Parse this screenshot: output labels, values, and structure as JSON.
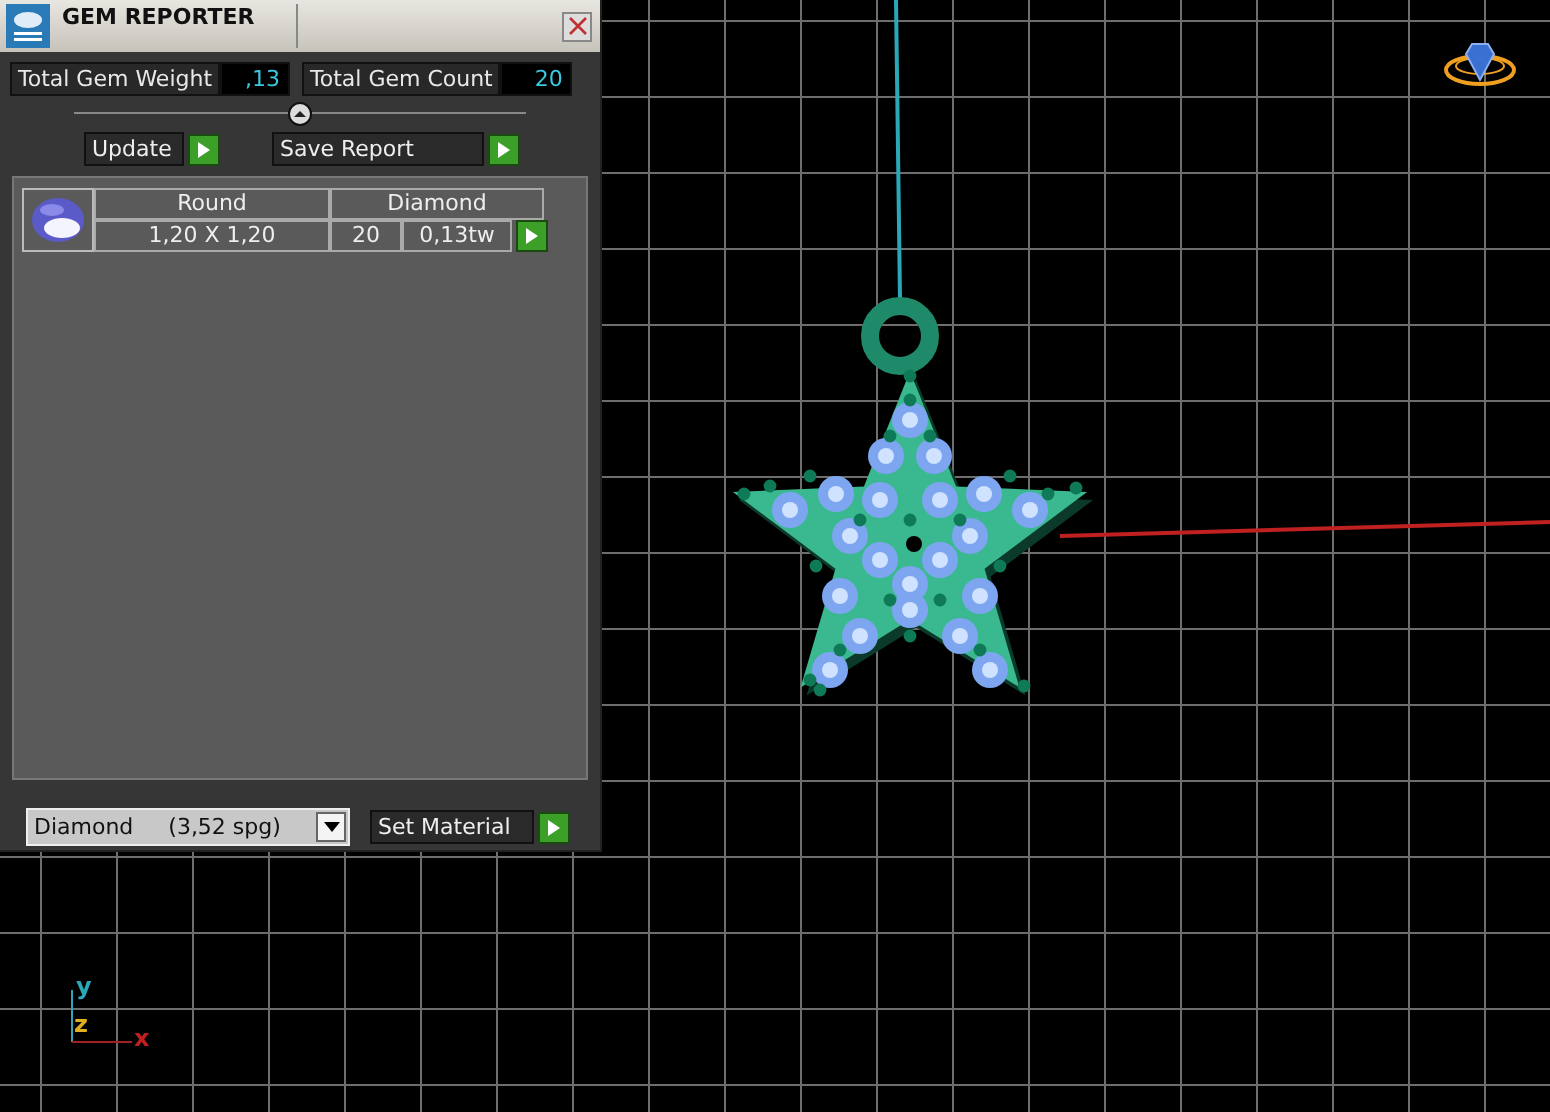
{
  "window": {
    "title": "GEM REPORTER"
  },
  "totals": [
    {
      "label": "Total Gem Weight",
      "value": ",13"
    },
    {
      "label": "Total Gem Count",
      "value": "20"
    }
  ],
  "actions": [
    "Update",
    "Save Report"
  ],
  "gems": [
    {
      "shape": "Round",
      "material": "Diamond",
      "size": "1,20 X 1,20",
      "count": "20",
      "weight": "0,13tw"
    }
  ],
  "material_select": {
    "value": "Diamond     (3,52 spg)"
  },
  "set_material_button": "Set Material",
  "axis_labels": {
    "y": "y",
    "z": "z",
    "x": "x"
  }
}
